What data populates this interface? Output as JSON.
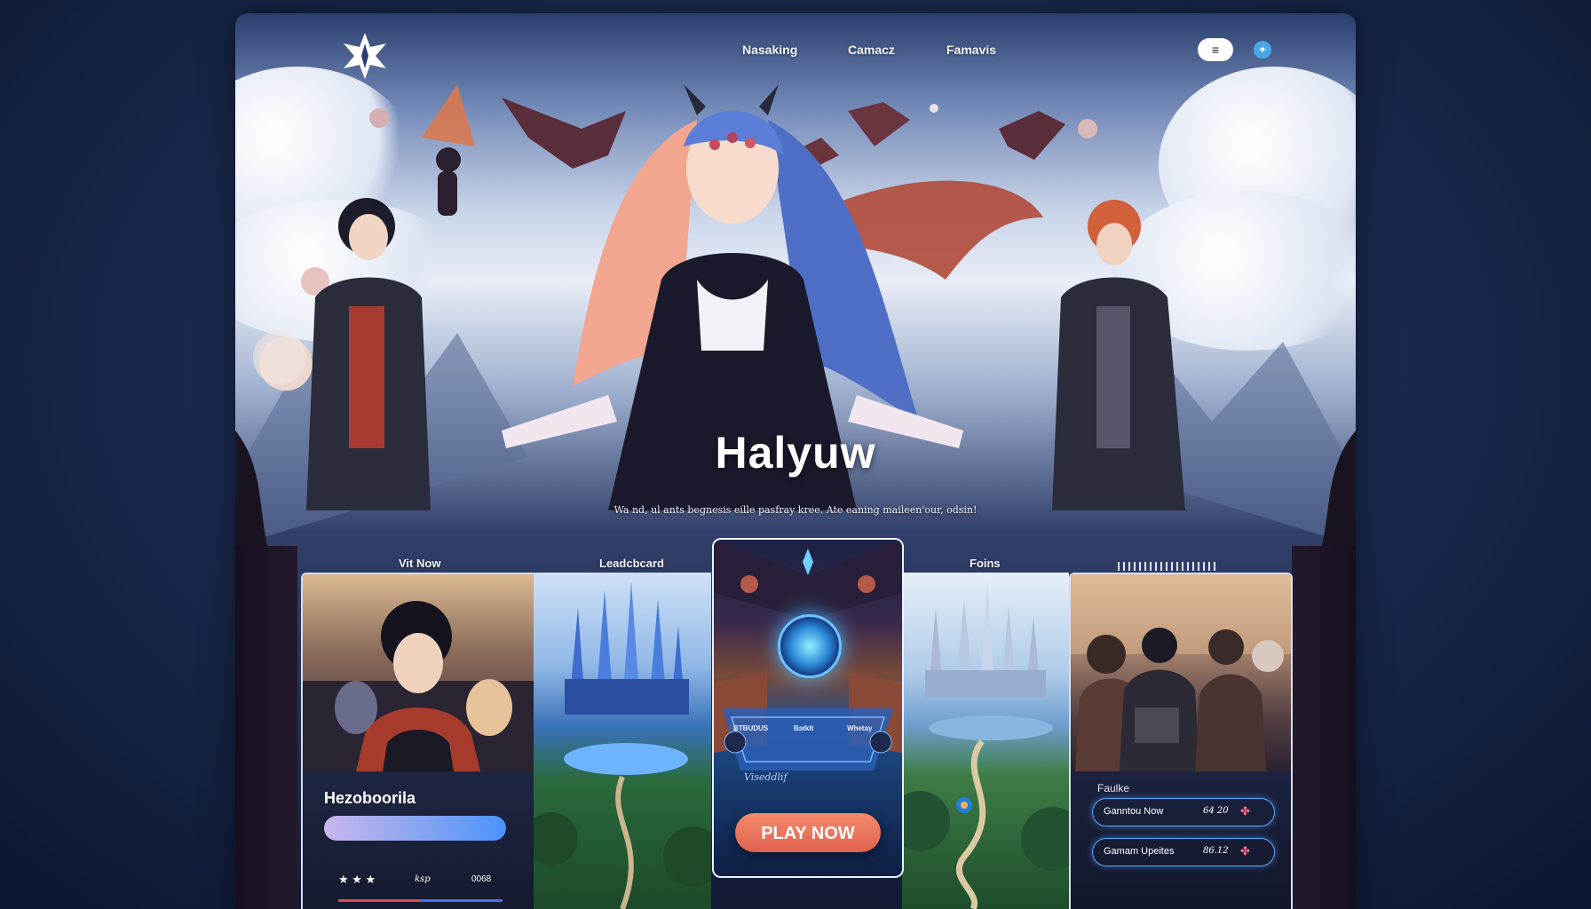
{
  "nav": {
    "items": [
      "Nasaking",
      "Camacz",
      "Famavis"
    ],
    "menu_icon": "≡",
    "globe_icon": "globe-icon"
  },
  "hero": {
    "title": "Halyuw",
    "subtitle": "Wa nd, ul ants begnesis eille pasfray kree. Ate eaning maileen'our, odsin!"
  },
  "sections": {
    "left": "Vit Now",
    "leaderboard": "Leadcbcard",
    "forums": "Foins"
  },
  "card_left": {
    "title": "Hezoboorila",
    "progress": 1.0,
    "stars": "★ ★ ★",
    "meta_a": "ksp",
    "meta_b": "0068"
  },
  "center_card": {
    "mini_items": [
      "BTBUDUS",
      "Batklt",
      "Whetay"
    ],
    "mini_label": "Viseddlif",
    "play_label": "PLAY NOW"
  },
  "card_right": {
    "title": "Faulke",
    "rows": [
      {
        "label": "Ganntou Now",
        "value": "64 20"
      },
      {
        "label": "Gamam Upeites",
        "value": "86.12"
      }
    ]
  },
  "colors": {
    "accent_blue": "#4a93ff",
    "play_button": "#e0614f",
    "panel_dark": "#1a2036"
  }
}
